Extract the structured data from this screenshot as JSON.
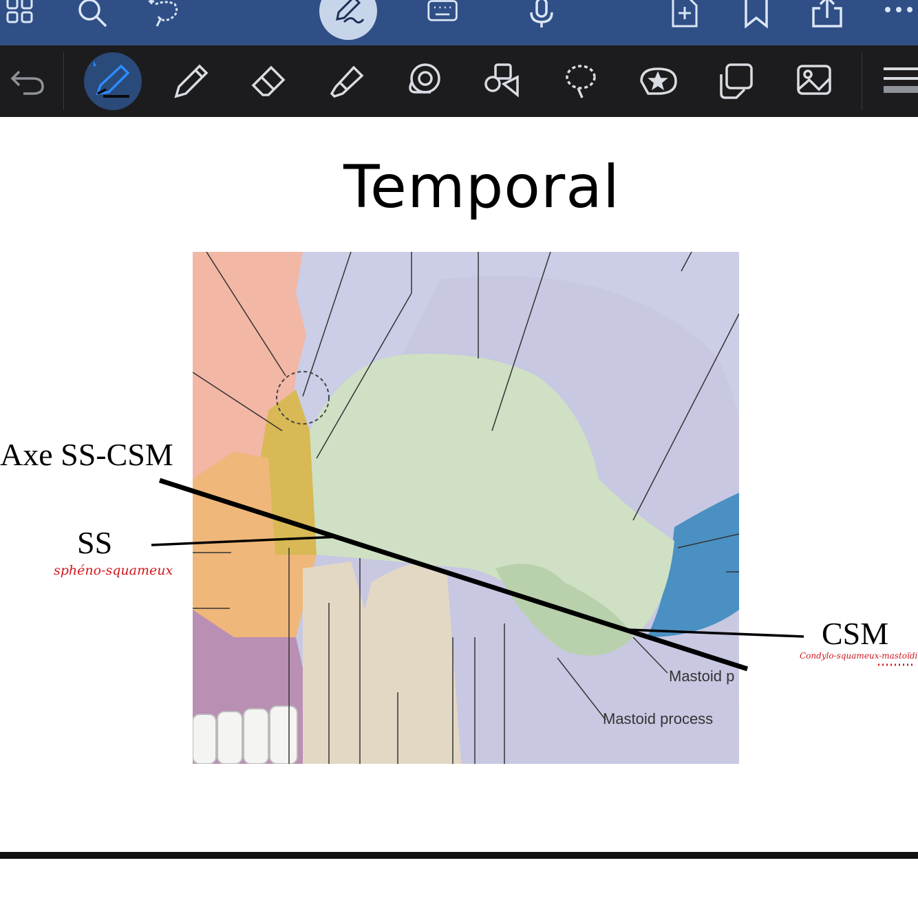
{
  "page": {
    "title": "Temporal"
  },
  "annotations": {
    "axis_label": "Axe SS-CSM",
    "ss_label": "SS",
    "ss_note": "sphéno-squameux",
    "csm_label": "CSM",
    "csm_note": "Condylo-squameux-mastoïdien"
  },
  "figure_labels": {
    "mastoid_partial": "Mastoid p",
    "mastoid_process": "Mastoid process"
  },
  "colors": {
    "top_bar": "#2f4f86",
    "tool_bar": "#1c1c1e",
    "note_red": "#d0161e",
    "temporal_bone": "#cfe0c4",
    "parietal_bone": "#cccde6",
    "sphenoid_bone": "#d8b956",
    "occipital_bone": "#4a90c2",
    "zygomatic_bone": "#f0b77a",
    "mandible": "#e3d8c4"
  },
  "icons": {
    "top": [
      "grid-icon",
      "search-icon",
      "lasso-add-icon",
      "pen-signature-icon",
      "keyboard-icon",
      "microphone-icon",
      "add-page-icon",
      "bookmark-icon",
      "share-icon",
      "more-icon"
    ],
    "tools": [
      "undo-icon",
      "fountain-pen-icon",
      "pencil-icon",
      "eraser-icon",
      "highlighter-icon",
      "spiral-shape-icon",
      "shapes-icon",
      "lasso-icon",
      "sticker-star-icon",
      "sticky-note-icon",
      "image-icon",
      "menu-icon"
    ]
  }
}
